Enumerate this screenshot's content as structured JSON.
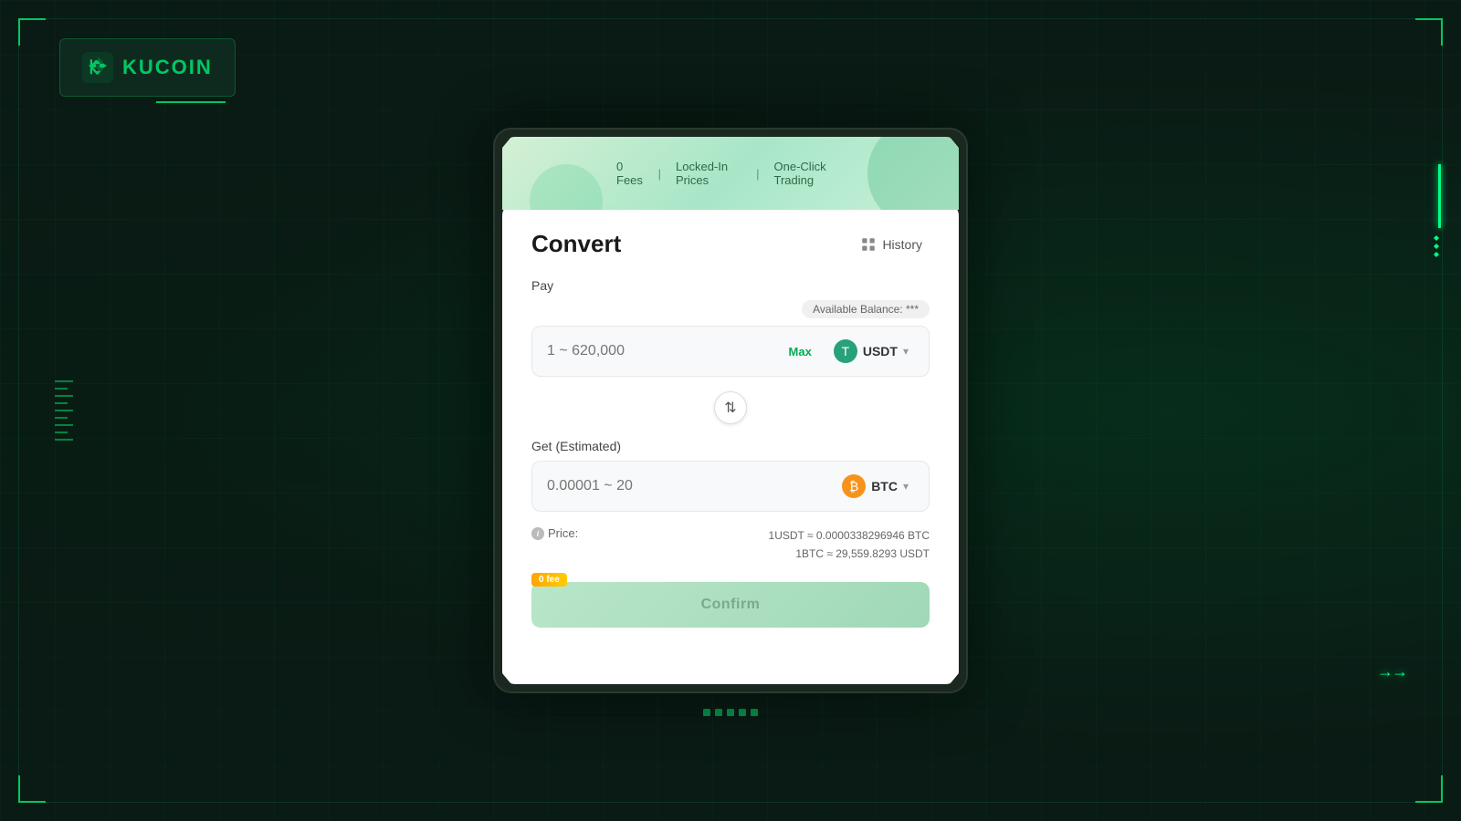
{
  "app": {
    "name": "KuCoin"
  },
  "background": {
    "color": "#0a1a14"
  },
  "logo": {
    "text": "KUCOIN"
  },
  "banner": {
    "features": [
      "0 Fees",
      "Locked-In Prices",
      "One-Click Trading"
    ],
    "divider": "|"
  },
  "convert": {
    "title": "Convert",
    "history_label": "History",
    "pay_label": "Pay",
    "available_balance_label": "Available Balance:",
    "available_balance_value": "***",
    "pay_placeholder": "1 ~ 620,000",
    "max_label": "Max",
    "pay_currency": "USDT",
    "pay_currency_icon": "T",
    "get_label": "Get (Estimated)",
    "get_placeholder": "0.00001 ~ 20",
    "get_currency": "BTC",
    "get_currency_icon": "₿",
    "price_label": "Price:",
    "price_line1": "1USDT ≈ 0.0000338296946 BTC",
    "price_line2": "1BTC ≈ 29,559.8293 USDT",
    "fee_badge": "0 fee",
    "confirm_label": "Confirm"
  }
}
